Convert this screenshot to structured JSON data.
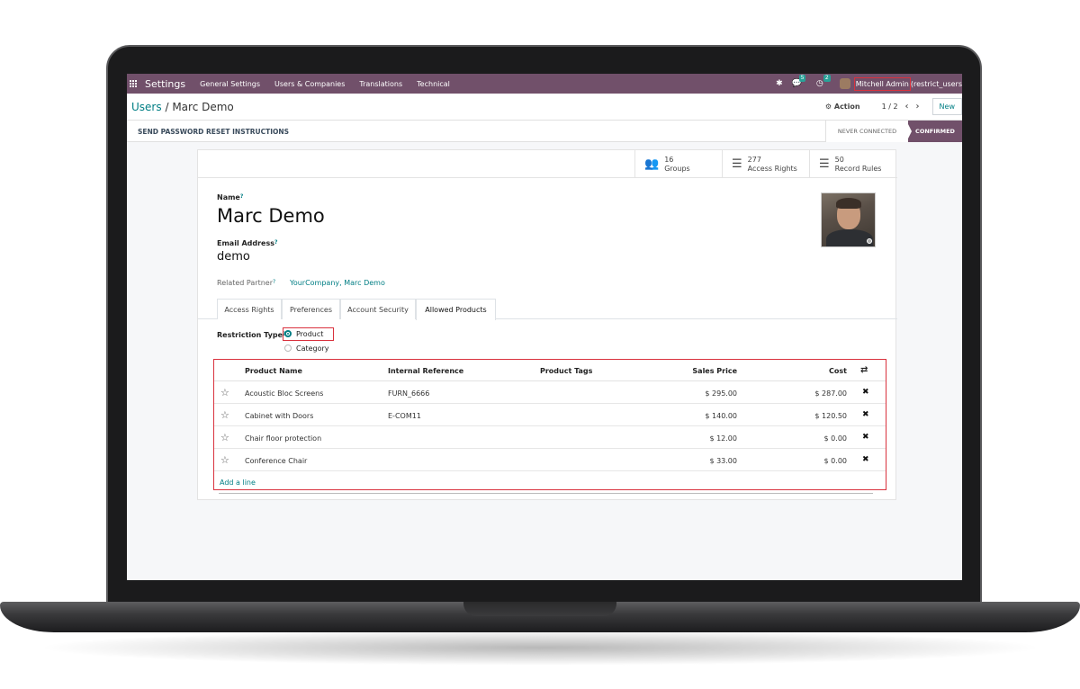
{
  "topbar": {
    "app_name": "Settings",
    "menu": [
      "General Settings",
      "Users & Companies",
      "Translations",
      "Technical"
    ],
    "messages_count": "5",
    "activities_count": "2",
    "user_name": "Mitchell Admin",
    "user_db": "(restrict_users"
  },
  "control_panel": {
    "breadcrumb_parent": "Users",
    "breadcrumb_sep": "/",
    "breadcrumb_current": "Marc Demo",
    "action_label": "Action",
    "pager_value": "1 / 2",
    "new_label": "New"
  },
  "statusbar": {
    "reset_label": "SEND PASSWORD RESET INSTRUCTIONS",
    "stage_never": "NEVER CONNECTED",
    "stage_confirmed": "CONFIRMED"
  },
  "smart_buttons": [
    {
      "count": "16",
      "label": "Groups"
    },
    {
      "count": "277",
      "label": "Access Rights"
    },
    {
      "count": "50",
      "label": "Record Rules"
    }
  ],
  "form": {
    "name_label": "Name",
    "name_value": "Marc Demo",
    "email_label": "Email Address",
    "email_value": "demo",
    "partner_label": "Related Partner",
    "partner_value": "YourCompany, Marc Demo",
    "help_mark": "?"
  },
  "tabs": [
    "Access Rights",
    "Preferences",
    "Account Security",
    "Allowed Products"
  ],
  "restriction": {
    "label": "Restriction Type",
    "options": [
      "Product",
      "Category"
    ],
    "selected": "Product"
  },
  "table": {
    "columns": [
      "Product Name",
      "Internal Reference",
      "Product Tags",
      "Sales Price",
      "Cost"
    ],
    "rows": [
      {
        "name": "Acoustic Bloc Screens",
        "ref": "FURN_6666",
        "tags": "",
        "price": "$ 295.00",
        "cost": "$ 287.00"
      },
      {
        "name": "Cabinet with Doors",
        "ref": "E-COM11",
        "tags": "",
        "price": "$ 140.00",
        "cost": "$ 120.50"
      },
      {
        "name": "Chair floor protection",
        "ref": "",
        "tags": "",
        "price": "$ 12.00",
        "cost": "$ 0.00"
      },
      {
        "name": "Conference Chair",
        "ref": "",
        "tags": "",
        "price": "$ 33.00",
        "cost": "$ 0.00"
      }
    ],
    "add_line": "Add a line"
  },
  "colors": {
    "brand": "#71506a",
    "link": "#017e84",
    "highlight": "#d9323e"
  },
  "icons": [
    "apps-icon",
    "bug-icon",
    "chat-icon",
    "clock-icon",
    "gear-icon",
    "users-icon",
    "list-icon",
    "star-icon",
    "delete-icon",
    "settings-toggle-icon"
  ]
}
